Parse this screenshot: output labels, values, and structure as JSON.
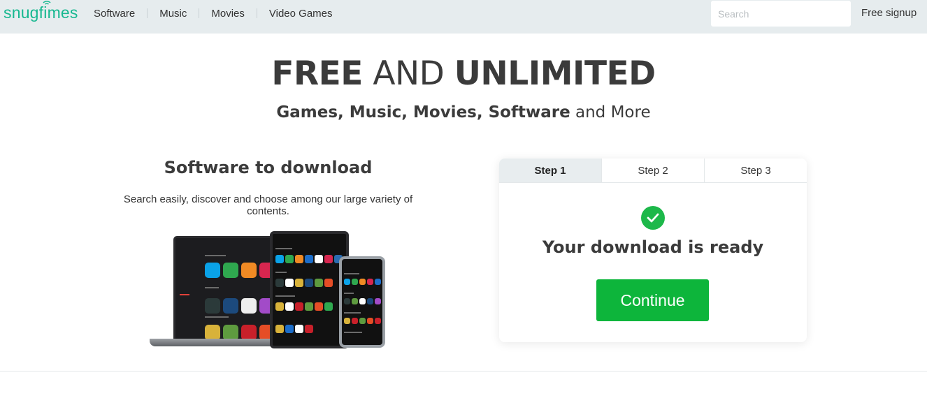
{
  "header": {
    "logo_text": "snugfimes",
    "nav": [
      "Software",
      "Music",
      "Movies",
      "Video Games"
    ],
    "search_placeholder": "Search",
    "signup_label": "Free signup"
  },
  "hero": {
    "title_bold_1": "FREE",
    "title_light": " AND ",
    "title_bold_2": "UNLIMITED",
    "subtitle_bold": "Games, Music, Movies, Software",
    "subtitle_light": " and More"
  },
  "promo": {
    "title": "Software to download",
    "description": "Search easily, discover and choose among our large variety of contents."
  },
  "steps": {
    "tabs": [
      "Step 1",
      "Step 2",
      "Step 3"
    ],
    "active_index": 0,
    "status_text": "Your download is ready",
    "continue_label": "Continue"
  },
  "colors": {
    "brand": "#17b890",
    "success": "#1db84a",
    "button": "#0db53b"
  }
}
